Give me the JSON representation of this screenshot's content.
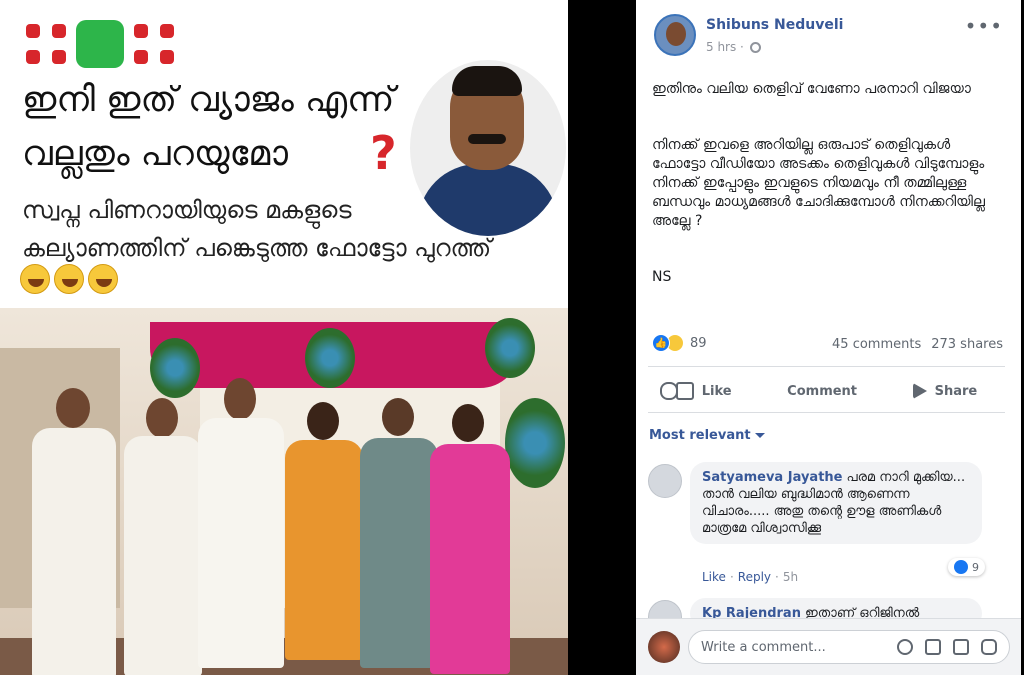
{
  "image_meme": {
    "line1": "ഇനി ഇത് വ്യാജം എന്ന്",
    "line2": "വല്ലതും പറയുമോ",
    "line3": "സ്വപ്ന പിണറായിയുടെ മകളുടെ",
    "line4": "കല്യാണത്തിന് പങ്കെടുത്ത ഫോട്ടോ പുറത്ത്",
    "question": "?"
  },
  "post": {
    "author": "Shibuns Neduveli",
    "time": "5 hrs ·",
    "more": "•••",
    "text_p1": "ഇതിനും വലിയ തെളിവ് വേണോ പരനാറി വിജയാ",
    "text_p2": "നിനക്ക് ഇവളെ അറിയില്ല ഒരുപാട് തെളിവുകൾ ഫോട്ടോ വീഡിയോ അടക്കം തെളിവുകൾ വിടുമ്പോളും നിനക്ക് ഇപ്പോളും ഇവളുടെ നിയമവും നീ തമ്മിലുള്ള ബന്ധവും മാധ്യമങ്ങൾ ചോദിക്കുമ്പോൾ നിനക്കറിയില്ല അല്ലേ ?",
    "text_p3": "NS",
    "reaction_count": "89",
    "comments_count": "45 comments",
    "shares_count": "273 shares",
    "actions": {
      "like": "Like",
      "comment": "Comment",
      "share": "Share"
    },
    "filter_label": "Most relevant"
  },
  "comments": [
    {
      "name": "Satyameva Jayathe",
      "text": "പരമ നാറി മുക്കിയ... താൻ വലിയ ബുദ്ധിമാൻ ആണെന്ന വിചാരം..... അതു തന്റെ ഊള അണികൾ മാത്രമേ വിശ്വാസിക്കൂ",
      "like": "Like",
      "reply": "Reply",
      "time": "5h",
      "reactions": "9"
    },
    {
      "name": "Kp Rajendran",
      "text": "ഇതാണ് ഒറിജിനൽ"
    }
  ],
  "composer": {
    "placeholder": "Write a comment..."
  },
  "colors": {
    "link": "#385898",
    "like_blue": "#1877f2",
    "accent_red": "#d7262b"
  }
}
